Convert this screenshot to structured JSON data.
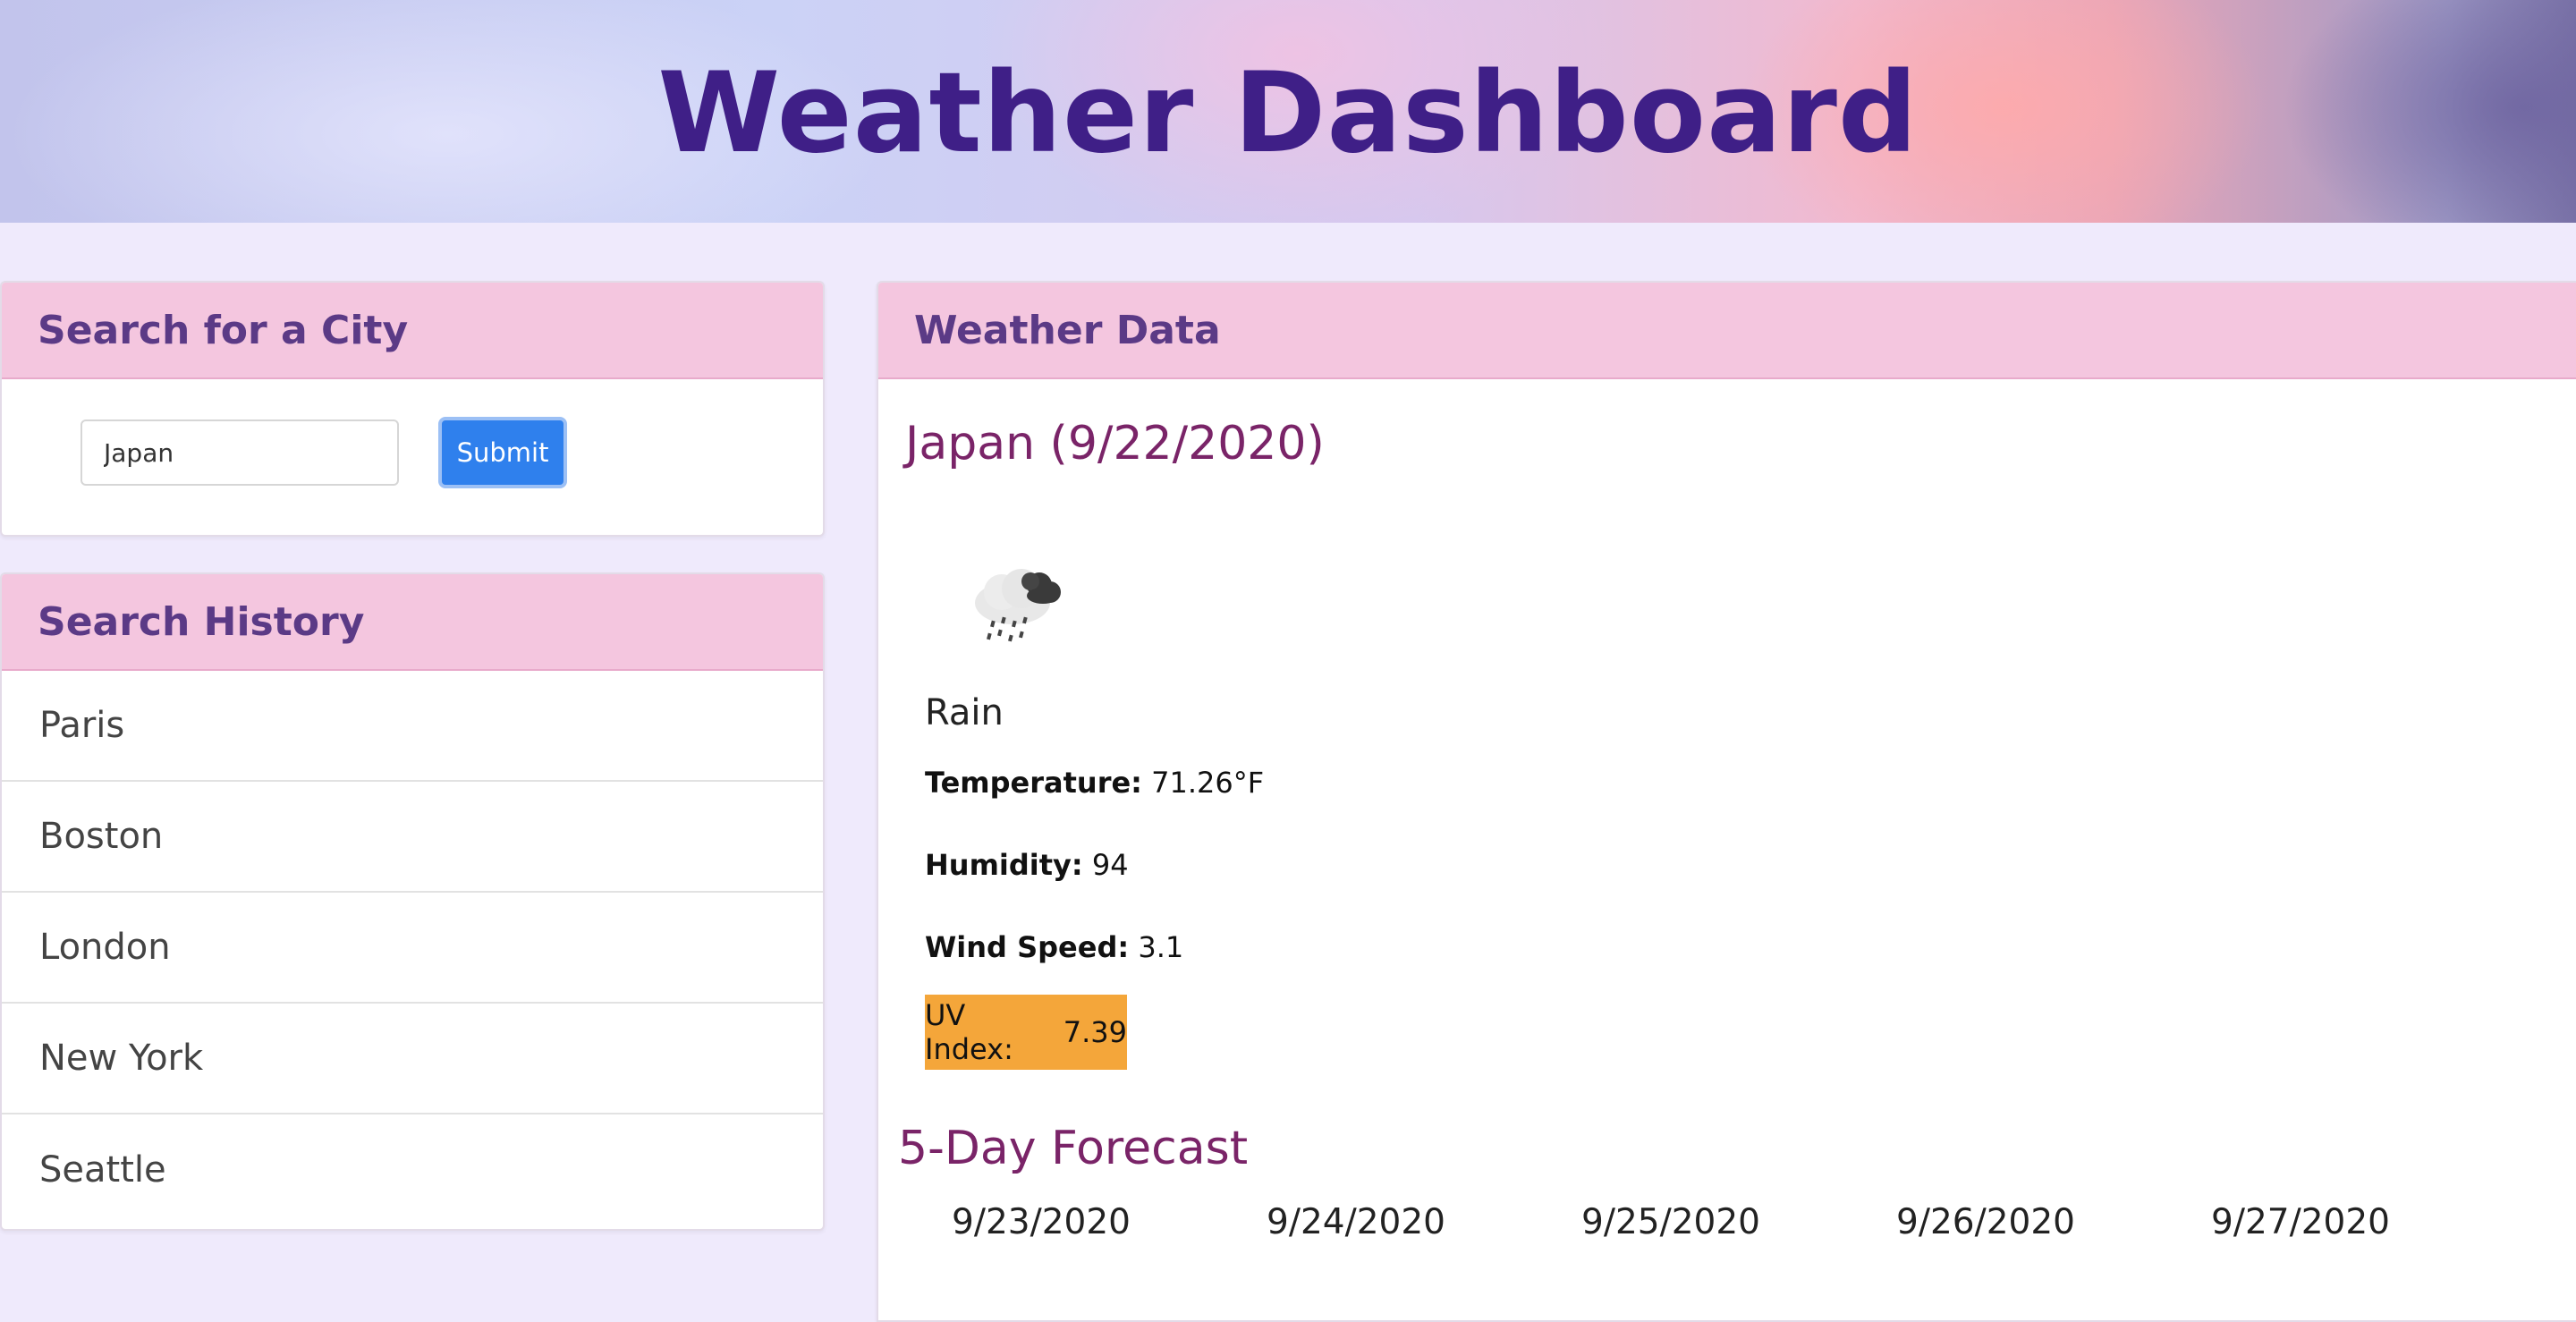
{
  "header": {
    "title": "Weather Dashboard"
  },
  "search": {
    "heading": "Search for a City",
    "input_value": "Japan",
    "submit_label": "Submit"
  },
  "history": {
    "heading": "Search History",
    "items": [
      {
        "label": "Paris"
      },
      {
        "label": "Boston"
      },
      {
        "label": "London"
      },
      {
        "label": "New York"
      },
      {
        "label": "Seattle"
      }
    ]
  },
  "weather": {
    "heading": "Weather Data",
    "city_title": "Japan (9/22/2020)",
    "icon": "rain-cloud-icon",
    "condition": "Rain",
    "temperature_label": "Temperature:",
    "temperature_value": "71.26°F",
    "humidity_label": "Humidity:",
    "humidity_value": "94",
    "wind_label": "Wind Speed:",
    "wind_value": "3.1",
    "uv_label": "UV Index:",
    "uv_value": "7.39",
    "uv_color": "#f4a63a",
    "forecast_title": "5-Day Forecast",
    "forecast": [
      {
        "date": "9/23/2020"
      },
      {
        "date": "9/24/2020"
      },
      {
        "date": "9/25/2020"
      },
      {
        "date": "9/26/2020"
      },
      {
        "date": "9/27/2020"
      }
    ]
  },
  "colors": {
    "accent_title": "#3f1f87",
    "card_header_bg": "#f4c6df",
    "card_header_text": "#5b3a86",
    "submit_bg": "#2f80ed",
    "city_title": "#7a2468"
  }
}
